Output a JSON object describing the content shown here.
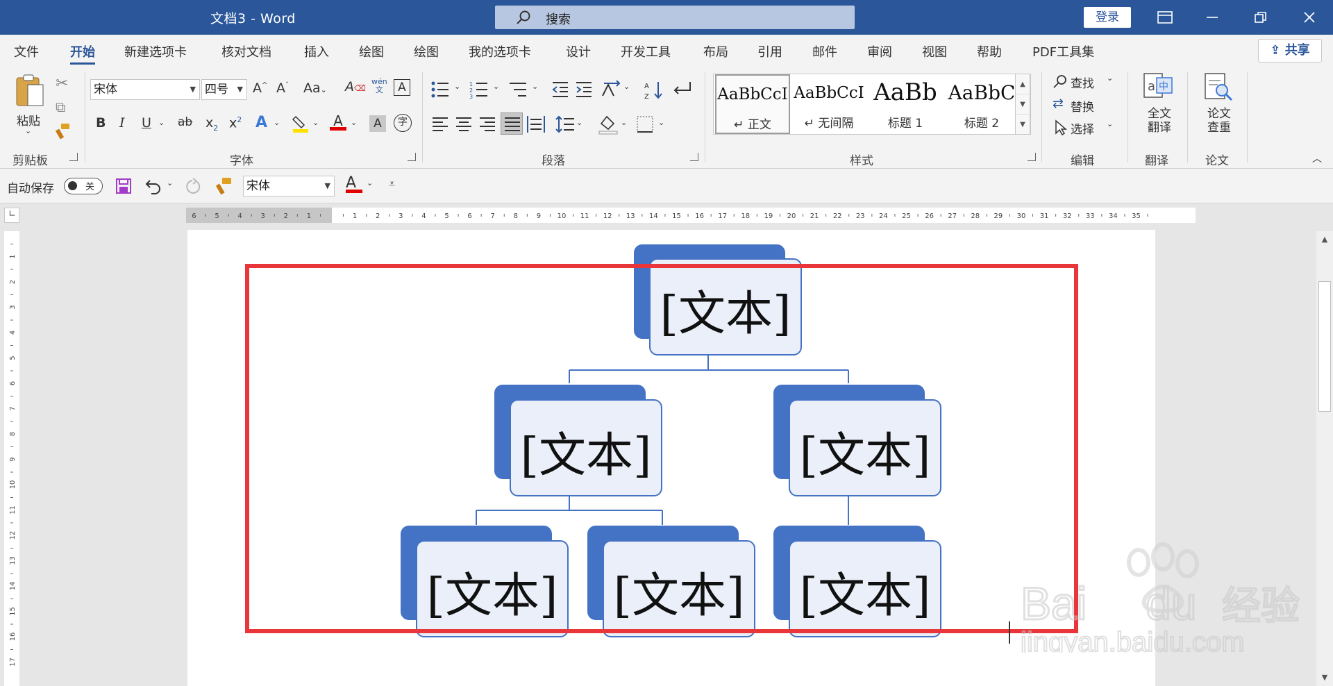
{
  "window": {
    "title": "文档3  -  Word",
    "search_placeholder": "搜索",
    "login_label": "登录"
  },
  "tabs": [
    {
      "label": "文件"
    },
    {
      "label": "开始"
    },
    {
      "label": "新建选项卡"
    },
    {
      "label": "核对文档"
    },
    {
      "label": "插入"
    },
    {
      "label": "绘图"
    },
    {
      "label": "绘图"
    },
    {
      "label": "我的选项卡"
    },
    {
      "label": "设计"
    },
    {
      "label": "开发工具"
    },
    {
      "label": "布局"
    },
    {
      "label": "引用"
    },
    {
      "label": "邮件"
    },
    {
      "label": "审阅"
    },
    {
      "label": "视图"
    },
    {
      "label": "帮助"
    },
    {
      "label": "PDF工具集"
    }
  ],
  "active_tab": "开始",
  "share_label": "共享",
  "ribbon": {
    "clipboard": {
      "paste_label": "粘贴",
      "group_label": "剪贴板"
    },
    "font": {
      "font_name": "宋体",
      "font_size": "四号",
      "group_label": "字体",
      "aa_label": "Aa",
      "wen_label": "wén"
    },
    "paragraph": {
      "group_label": "段落"
    },
    "styles": {
      "group_label": "样式",
      "items": [
        {
          "sample": "AaBbCcI",
          "name": "↵ 正文"
        },
        {
          "sample": "AaBbCcI",
          "name": "↵ 无间隔"
        },
        {
          "sample": "AaBb",
          "name": "标题 1"
        },
        {
          "sample": "AaBbC",
          "name": "标题 2"
        }
      ]
    },
    "editing": {
      "find_label": "查找",
      "replace_label": "替换",
      "select_label": "选择",
      "group_label": "编辑"
    },
    "translate": {
      "full_label": "全文翻译",
      "group_label": "翻译"
    },
    "paper": {
      "check_label": "论文查重",
      "group_label": "论文"
    }
  },
  "qat": {
    "autosave_label": "自动保存",
    "toggle_state": "关",
    "font_name": "宋体"
  },
  "document": {
    "smartart_nodes": [
      {
        "text": "[文本]"
      },
      {
        "text": "[文本]"
      },
      {
        "text": "[文本]"
      },
      {
        "text": "[文本]"
      },
      {
        "text": "[文本]"
      },
      {
        "text": "[文本]"
      }
    ]
  },
  "colors": {
    "titlebar": "#2b579a",
    "node_back": "#4472c4",
    "node_front": "#eaeff9",
    "selection": "#e8363b"
  }
}
